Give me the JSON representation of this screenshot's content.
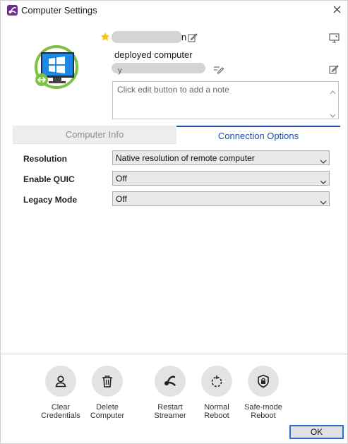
{
  "window": {
    "title": "Computer Settings",
    "close_label": "×"
  },
  "header": {
    "name_tail": "n",
    "description": "deployed computer",
    "id_tail": "y"
  },
  "note": {
    "placeholder": "Click edit button to add a note"
  },
  "tabs": [
    {
      "label": "Computer Info",
      "active": false
    },
    {
      "label": "Connection Options",
      "active": true
    }
  ],
  "options": [
    {
      "label": "Resolution",
      "value": "Native resolution of remote computer"
    },
    {
      "label": "Enable QUIC",
      "value": "Off"
    },
    {
      "label": "Legacy Mode",
      "value": "Off"
    }
  ],
  "actions": [
    {
      "line1": "Clear",
      "line2": "Credentials",
      "icon": "person-icon"
    },
    {
      "line1": "Delete",
      "line2": "Computer",
      "icon": "trash-icon"
    },
    {
      "line1": "Restart",
      "line2": "Streamer",
      "icon": "streamer-icon"
    },
    {
      "line1": "Normal",
      "line2": "Reboot",
      "icon": "reboot-icon"
    },
    {
      "line1": "Safe-mode",
      "line2": "Reboot",
      "icon": "shield-lock-icon"
    }
  ],
  "footer": {
    "ok_label": "OK"
  },
  "colors": {
    "accent": "#2050a6",
    "brand": "#6b2c8f",
    "windows_blue": "#1e88e5",
    "ring_green": "#7cc242",
    "star": "#f5c518"
  }
}
